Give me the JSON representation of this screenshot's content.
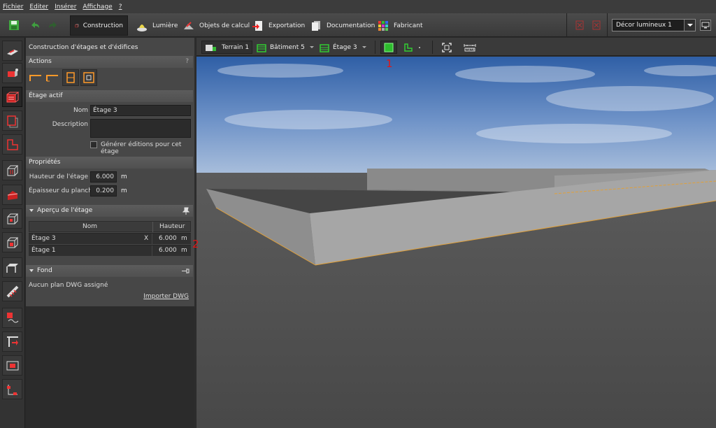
{
  "menu": [
    "Fichier",
    "Editer",
    "Insérer",
    "Affichage",
    "?"
  ],
  "tabs": [
    {
      "label": "Construction",
      "icon": "construction-icon",
      "active": true
    },
    {
      "label": "Lumière",
      "icon": "lamp-icon"
    },
    {
      "label": "Objets de calcul",
      "icon": "calc-objects-icon"
    },
    {
      "label": "Exportation",
      "icon": "export-icon"
    },
    {
      "label": "Documentation",
      "icon": "documentation-icon"
    },
    {
      "label": "Fabricant",
      "icon": "manufacturer-icon"
    }
  ],
  "scene_select": {
    "value": "Décor lumineux 1"
  },
  "panel": {
    "title": "Construction d'étages et d'édifices",
    "actions": {
      "title": "Actions",
      "help": "?"
    },
    "active_floor": {
      "title": "Étage actif",
      "name_label": "Nom",
      "name_value": "Étage 3",
      "desc_label": "Description",
      "desc_value": "",
      "checkbox_label": "Générer éditions pour cet étage"
    },
    "properties": {
      "title": "Propriétés",
      "height_label": "Hauteur de l'étage",
      "height_value": "6.000",
      "height_unit": "m",
      "thickness_label": "Épaisseur du plancher",
      "thickness_value": "0.200",
      "thickness_unit": "m"
    },
    "overview": {
      "title": "Aperçu de l'étage",
      "col_name": "Nom",
      "col_height": "Hauteur",
      "rows": [
        {
          "name": "Étage 3",
          "mark": "X",
          "height": "6.000",
          "unit": "m"
        },
        {
          "name": "Étage 1",
          "mark": "",
          "height": "6.000",
          "unit": "m"
        }
      ]
    },
    "background": {
      "title": "Fond",
      "text": "Aucun plan DWG assigné",
      "link": "Importer DWG"
    }
  },
  "viewtoolbar": {
    "terrain": "Terrain 1",
    "building": "Bâtiment 5",
    "floor": "Étage 3"
  },
  "annotations": {
    "one": "1",
    "two": "2"
  },
  "colors": {
    "accent": "#ff8c1a",
    "panel": "#474747",
    "sky": "#3f6db0"
  }
}
